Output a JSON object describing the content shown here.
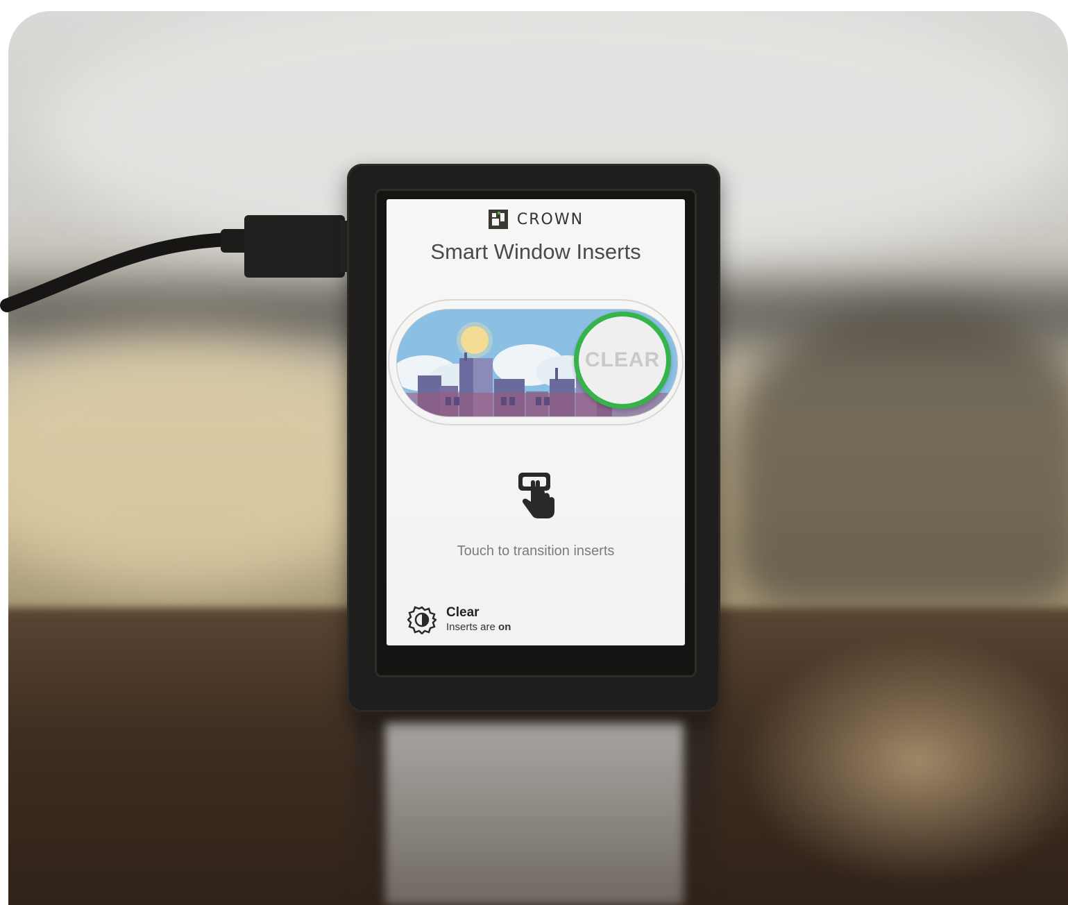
{
  "device_screen": {
    "brand": "CROWN",
    "title": "Smart Window Inserts",
    "toggle": {
      "label": "CLEAR",
      "state": "on",
      "accent_color": "#36b34a"
    },
    "hint": "Touch to transition inserts",
    "status": {
      "title": "Clear",
      "prefix": "Inserts are",
      "value": "on"
    },
    "icons": {
      "logo": "crown-logo-icon",
      "touch": "touch-hand-icon",
      "status": "status-gear-icon"
    }
  }
}
